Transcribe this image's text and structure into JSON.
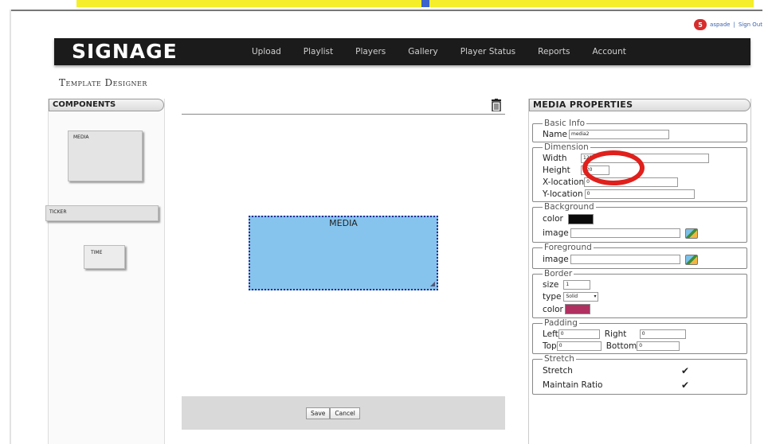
{
  "user": {
    "notifications": "5",
    "username": "aspade",
    "separator": "|",
    "signout": "Sign Out"
  },
  "header": {
    "logo": "SIGNAGE",
    "nav": [
      "Upload",
      "Playlist",
      "Players",
      "Gallery",
      "Player Status",
      "Reports",
      "Account"
    ]
  },
  "page": {
    "title": "Template Designer"
  },
  "components": {
    "title": "COMPONENTS",
    "items": [
      {
        "label": "MEDIA"
      },
      {
        "label": "TICKER"
      },
      {
        "label": "TIME"
      }
    ]
  },
  "canvas": {
    "media_label": "MEDIA",
    "save_label": "Save",
    "cancel_label": "Cancel"
  },
  "properties": {
    "title": "MEDIA PROPERTIES",
    "basic_info": {
      "legend": "Basic Info",
      "name_label": "Name",
      "name_value": "media2"
    },
    "dimension": {
      "legend": "Dimension",
      "width_label": "Width",
      "width_value": "1280",
      "height_label": "Height",
      "height_value": "720",
      "x_label": "X-location",
      "x_value": "0",
      "y_label": "Y-location",
      "y_value": "0"
    },
    "background": {
      "legend": "Background",
      "color_label": "color",
      "color_value": "#0a0a0a",
      "image_label": "image",
      "image_value": ""
    },
    "foreground": {
      "legend": "Foreground",
      "image_label": "image",
      "image_value": ""
    },
    "border": {
      "legend": "Border",
      "size_label": "size",
      "size_value": "1",
      "type_label": "type",
      "type_value": "Solid",
      "color_label": "color",
      "color_value": "#b03060"
    },
    "padding": {
      "legend": "Padding",
      "left_label": "Left",
      "left_value": "0",
      "right_label": "Right",
      "right_value": "0",
      "top_label": "Top",
      "top_value": "0",
      "bottom_label": "Bottom",
      "bottom_value": "0"
    },
    "stretch": {
      "legend": "Stretch",
      "stretch_label": "Stretch",
      "stretch_checked": true,
      "ratio_label": "Maintain Ratio",
      "ratio_checked": true
    }
  },
  "colors": {
    "navbar": "#1b1b1b",
    "media_box": "#86c4ee",
    "highlight_circle": "#e0201c",
    "top_banner": "#f4ef2a"
  }
}
